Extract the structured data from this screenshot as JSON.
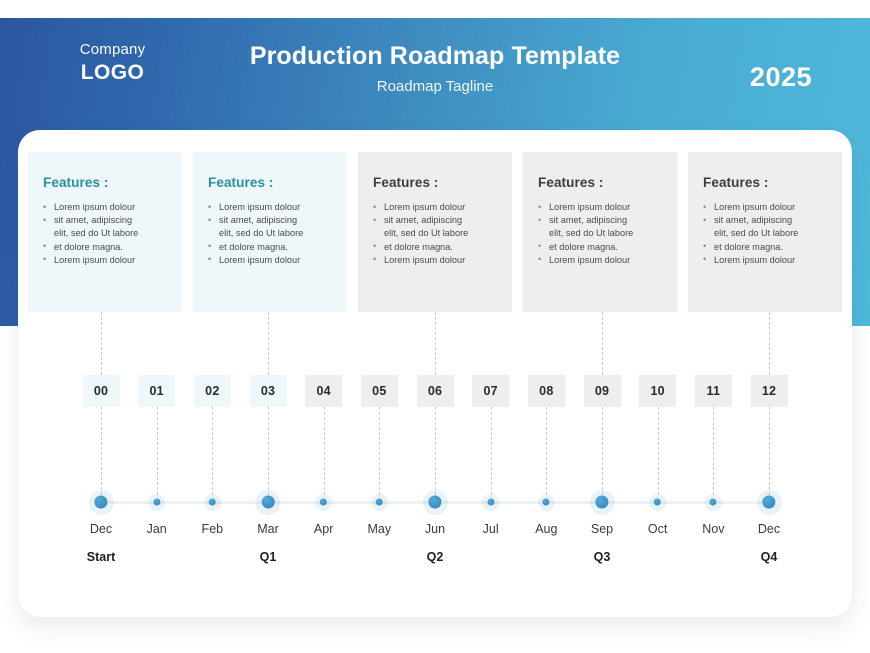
{
  "header": {
    "logo_company": "Company",
    "logo_name": "LOGO",
    "title": "Production Roadmap Template",
    "tagline": "Roadmap Tagline",
    "year": "2025",
    "gradient_from": "#2c57a0",
    "gradient_to": "#4fb9da"
  },
  "cards": [
    {
      "title": "Features :",
      "theme": "blue",
      "bullets": [
        "Lorem ipsum dolour",
        "sit amet, adipiscing",
        "elit, sed do Ut labore",
        "et dolore magna.",
        "Lorem ipsum dolour"
      ],
      "continuation_index": 2
    },
    {
      "title": "Features :",
      "theme": "blue",
      "bullets": [
        "Lorem ipsum dolour",
        "sit amet, adipiscing",
        "elit, sed do Ut labore",
        "et dolore magna.",
        "Lorem ipsum dolour"
      ],
      "continuation_index": 2
    },
    {
      "title": "Features :",
      "theme": "gray",
      "bullets": [
        "Lorem ipsum dolour",
        "sit amet, adipiscing",
        "elit, sed do Ut labore",
        "et dolore magna.",
        "Lorem ipsum dolour"
      ],
      "continuation_index": 2
    },
    {
      "title": "Features :",
      "theme": "gray",
      "bullets": [
        "Lorem ipsum dolour",
        "sit amet, adipiscing",
        "elit, sed do Ut labore",
        "et dolore magna.",
        "Lorem ipsum dolour"
      ],
      "continuation_index": 2
    },
    {
      "title": "Features :",
      "theme": "gray",
      "bullets": [
        "Lorem ipsum dolour",
        "sit amet, adipiscing",
        "elit, sed do Ut labore",
        "et dolore magna.",
        "Lorem ipsum dolour"
      ],
      "continuation_index": 2
    }
  ],
  "chips": [
    {
      "label": "00",
      "theme": "blue"
    },
    {
      "label": "01",
      "theme": "blue"
    },
    {
      "label": "02",
      "theme": "blue"
    },
    {
      "label": "03",
      "theme": "blue"
    },
    {
      "label": "04",
      "theme": "gray"
    },
    {
      "label": "05",
      "theme": "gray"
    },
    {
      "label": "06",
      "theme": "gray"
    },
    {
      "label": "07",
      "theme": "gray"
    },
    {
      "label": "08",
      "theme": "gray"
    },
    {
      "label": "09",
      "theme": "gray"
    },
    {
      "label": "10",
      "theme": "gray"
    },
    {
      "label": "11",
      "theme": "gray"
    },
    {
      "label": "12",
      "theme": "gray"
    }
  ],
  "timeline": {
    "months": [
      {
        "label": "Dec",
        "size": "major"
      },
      {
        "label": "Jan",
        "size": "minor"
      },
      {
        "label": "Feb",
        "size": "minor"
      },
      {
        "label": "Mar",
        "size": "major"
      },
      {
        "label": "Apr",
        "size": "minor"
      },
      {
        "label": "May",
        "size": "minor"
      },
      {
        "label": "Jun",
        "size": "major"
      },
      {
        "label": "Jul",
        "size": "minor"
      },
      {
        "label": "Aug",
        "size": "minor"
      },
      {
        "label": "Sep",
        "size": "major"
      },
      {
        "label": "Oct",
        "size": "minor"
      },
      {
        "label": "Nov",
        "size": "minor"
      },
      {
        "label": "Dec",
        "size": "major"
      }
    ],
    "quarters": [
      {
        "label": "Start",
        "month_index": 0
      },
      {
        "label": "Q1",
        "month_index": 3
      },
      {
        "label": "Q2",
        "month_index": 6
      },
      {
        "label": "Q3",
        "month_index": 9
      },
      {
        "label": "Q4",
        "month_index": 12
      }
    ],
    "dot_color": "#3a8fc6",
    "track_color": "#eef1f3"
  }
}
